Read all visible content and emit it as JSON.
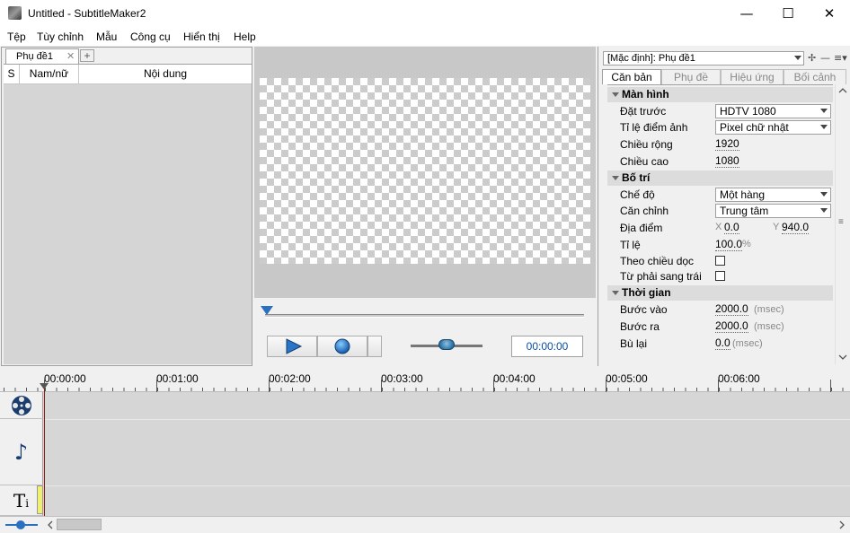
{
  "window": {
    "title": "Untitled - SubtitleMaker2",
    "minimize": "—",
    "maximize": "☐",
    "close": "✕"
  },
  "menu": [
    "Tệp",
    "Tùy chỉnh",
    "Mẫu",
    "Công cụ",
    "Hiển thị",
    "Help"
  ],
  "subtitle_tabs": {
    "active": "Phụ đề1",
    "close": "✕",
    "add": "+"
  },
  "list_columns": [
    "S",
    "Nam/nữ",
    "Nội dung"
  ],
  "player": {
    "timecode": "00:00:00",
    "seek_position": 0,
    "volume_level": 0.5
  },
  "style_panel": {
    "preset": "[Mặc định]: Phụ đề1",
    "tabs": [
      "Căn bản",
      "Phụ đề",
      "Hiệu ứng",
      "Bối cảnh"
    ],
    "active_tab": "Căn bản",
    "sections": {
      "screen": {
        "title": "Màn hình",
        "preset_label": "Đặt trước",
        "preset_value": "HDTV 1080",
        "aspect_label": "Tỉ lệ điểm ảnh",
        "aspect_value": "Pixel chữ nhật",
        "width_label": "Chiều rộng",
        "width_value": "1920",
        "height_label": "Chiều cao",
        "height_value": "1080"
      },
      "layout": {
        "title": "Bố trí",
        "mode_label": "Chế độ",
        "mode_value": "Một hàng",
        "align_label": "Căn chỉnh",
        "align_value": "Trung tâm",
        "position_label": "Địa điểm",
        "x_label": "X",
        "x_value": "0.0",
        "y_label": "Y",
        "y_value": "940.0",
        "scale_label": "Tỉ lệ",
        "scale_value": "100.0",
        "scale_unit": "%",
        "vertical_label": "Theo chiều dọc",
        "vertical_checked": false,
        "rtl_label": "Từ phải sang trái",
        "rtl_checked": false
      },
      "time": {
        "title": "Thời gian",
        "in_label": "Bước vào",
        "in_value": "2000.0",
        "in_unit": "(msec)",
        "out_label": "Bước ra",
        "out_value": "2000.0",
        "out_unit": "(msec)",
        "offset_label": "Bù lại",
        "offset_value": "0.0",
        "offset_unit": "(msec)"
      }
    }
  },
  "timeline": {
    "ticks": [
      "00:00:00",
      "00:01:00",
      "00:02:00",
      "00:03:00",
      "00:04:00",
      "00:05:00",
      "00:06:00"
    ]
  }
}
